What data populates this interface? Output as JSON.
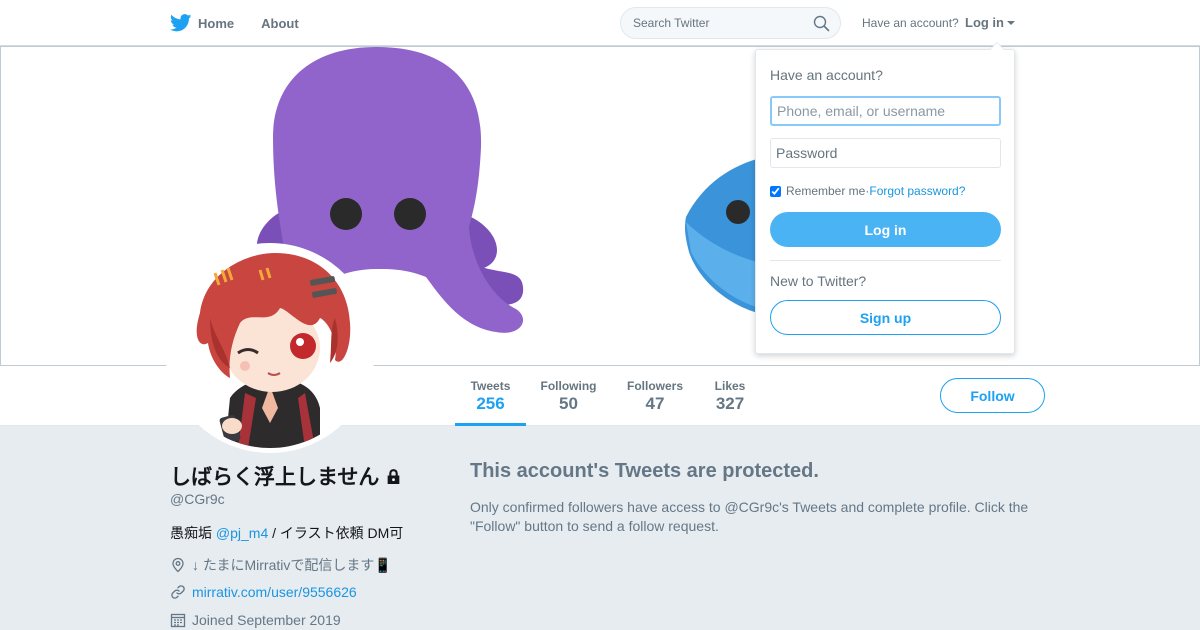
{
  "nav": {
    "home_label": "Home",
    "about_label": "About",
    "search_placeholder": "Search Twitter",
    "account_question": "Have an account?",
    "login_label": "Log in"
  },
  "profile": {
    "display_name": "しばらく浮上しません",
    "handle": "@CGr9c",
    "bio_prefix": "愚痴垢 ",
    "bio_mention": "@pj_m4",
    "bio_suffix": " / イラスト依頼 DM可",
    "location": "↓ たまにMirrativで配信します📱",
    "url": "mirrativ.com/user/9556626",
    "joined": "Joined September 2019"
  },
  "stats": [
    {
      "label": "Tweets",
      "value": "256"
    },
    {
      "label": "Following",
      "value": "50"
    },
    {
      "label": "Followers",
      "value": "47"
    },
    {
      "label": "Likes",
      "value": "327"
    }
  ],
  "follow_label": "Follow",
  "protected": {
    "title": "This account's Tweets are protected.",
    "description": "Only confirmed followers have access to @CGr9c's Tweets and complete profile. Click the \"Follow\" button to send a follow request."
  },
  "login_dropdown": {
    "title": "Have an account?",
    "username_placeholder": "Phone, email, or username",
    "password_placeholder": "Password",
    "remember_label": "Remember me",
    "separator": " · ",
    "forgot_label": "Forgot password?",
    "login_button": "Log in",
    "new_label": "New to Twitter?",
    "signup_button": "Sign up"
  },
  "colors": {
    "brand_blue": "#1da1f2",
    "link_blue": "#1b95e0",
    "login_button_bg": "#4ab3f4",
    "page_bg": "#e6ecf0",
    "muted_text": "#657786",
    "banner_octopus": "#9164cc",
    "banner_fish": "#3b94d9"
  },
  "icons": [
    "twitter-bird-icon",
    "search-icon",
    "lock-icon",
    "location-icon",
    "link-icon",
    "calendar-icon"
  ]
}
